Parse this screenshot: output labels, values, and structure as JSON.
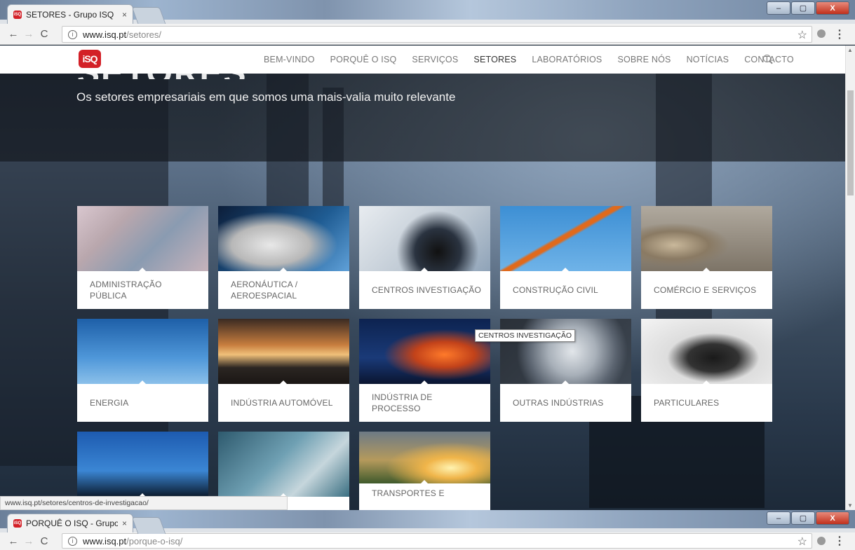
{
  "window1": {
    "tab_title": "SETORES - Grupo ISQ",
    "tab_close": "×",
    "url_host": "www.isq.pt",
    "url_path": "/setores/",
    "controls": {
      "minimize": "–",
      "maximize": "▢",
      "close": "X"
    }
  },
  "nav": {
    "back": "←",
    "forward": "→",
    "reload": "C",
    "info": "i",
    "star": "☆",
    "menu": "⋮"
  },
  "site": {
    "logo_text": "iSQ",
    "menu": [
      "BEM-VINDO",
      "PORQUÊ O ISQ",
      "SERVIÇOS",
      "SETORES",
      "LABORATÓRIOS",
      "SOBRE NÓS",
      "NOTÍCIAS",
      "CONTACTO"
    ],
    "active_menu": "SETORES",
    "page_title": "SETORES",
    "subtitle": "Os setores empresariais em que somos uma mais-valia muito relevante"
  },
  "sectors": [
    "ADMINISTRAÇÃO PÚBLICA",
    "AERONÁUTICA / AEROESPACIAL",
    "CENTROS INVESTIGAÇÃO",
    "CONSTRUÇÃO CIVIL",
    "COMÉRCIO E SERVIÇOS",
    "ENERGIA",
    "INDÚSTRIA AUTOMÓVEL",
    "INDÚSTRIA DE PROCESSO",
    "OUTRAS INDÚSTRIAS",
    "PARTICULARES",
    "",
    "",
    "TRANSPORTES E"
  ],
  "tooltip": "CENTROS INVESTIGAÇÃO",
  "status_url": "www.isq.pt/setores/centros-de-investigacao/",
  "window2": {
    "tab_title": "PORQUÊ O ISQ - Grupo I",
    "tab_close": "×",
    "url_host": "www.isq.pt",
    "url_path": "/porque-o-isq/",
    "controls": {
      "minimize": "–",
      "maximize": "▢",
      "close": "X"
    }
  },
  "colors": {
    "brand_red": "#d32027",
    "nav_text": "#777777",
    "card_label": "#666666"
  }
}
